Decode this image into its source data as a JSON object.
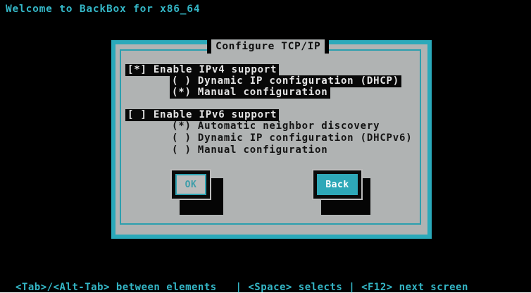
{
  "screen": {
    "title": "Welcome to BackBox for x86_64"
  },
  "dialog": {
    "title": "Configure TCP/IP",
    "ipv4": {
      "label": "[*] Enable IPv4 support",
      "options": [
        "( ) Dynamic IP configuration (DHCP)",
        "(*) Manual configuration"
      ]
    },
    "ipv6": {
      "label": "[ ] Enable IPv6 support",
      "options": [
        "(*) Automatic neighbor discovery",
        "( ) Dynamic IP configuration (DHCPv6)",
        "( ) Manual configuration"
      ]
    },
    "buttons": {
      "ok": "OK",
      "back": "Back"
    }
  },
  "footer": {
    "help": "<Tab>/<Alt-Tab> between elements   | <Space> selects | <F12> next screen"
  },
  "colors": {
    "background": "#000000",
    "dialog_body": "#b0b3b3",
    "accent": "#2aa9ba",
    "highlight": "#080808"
  }
}
